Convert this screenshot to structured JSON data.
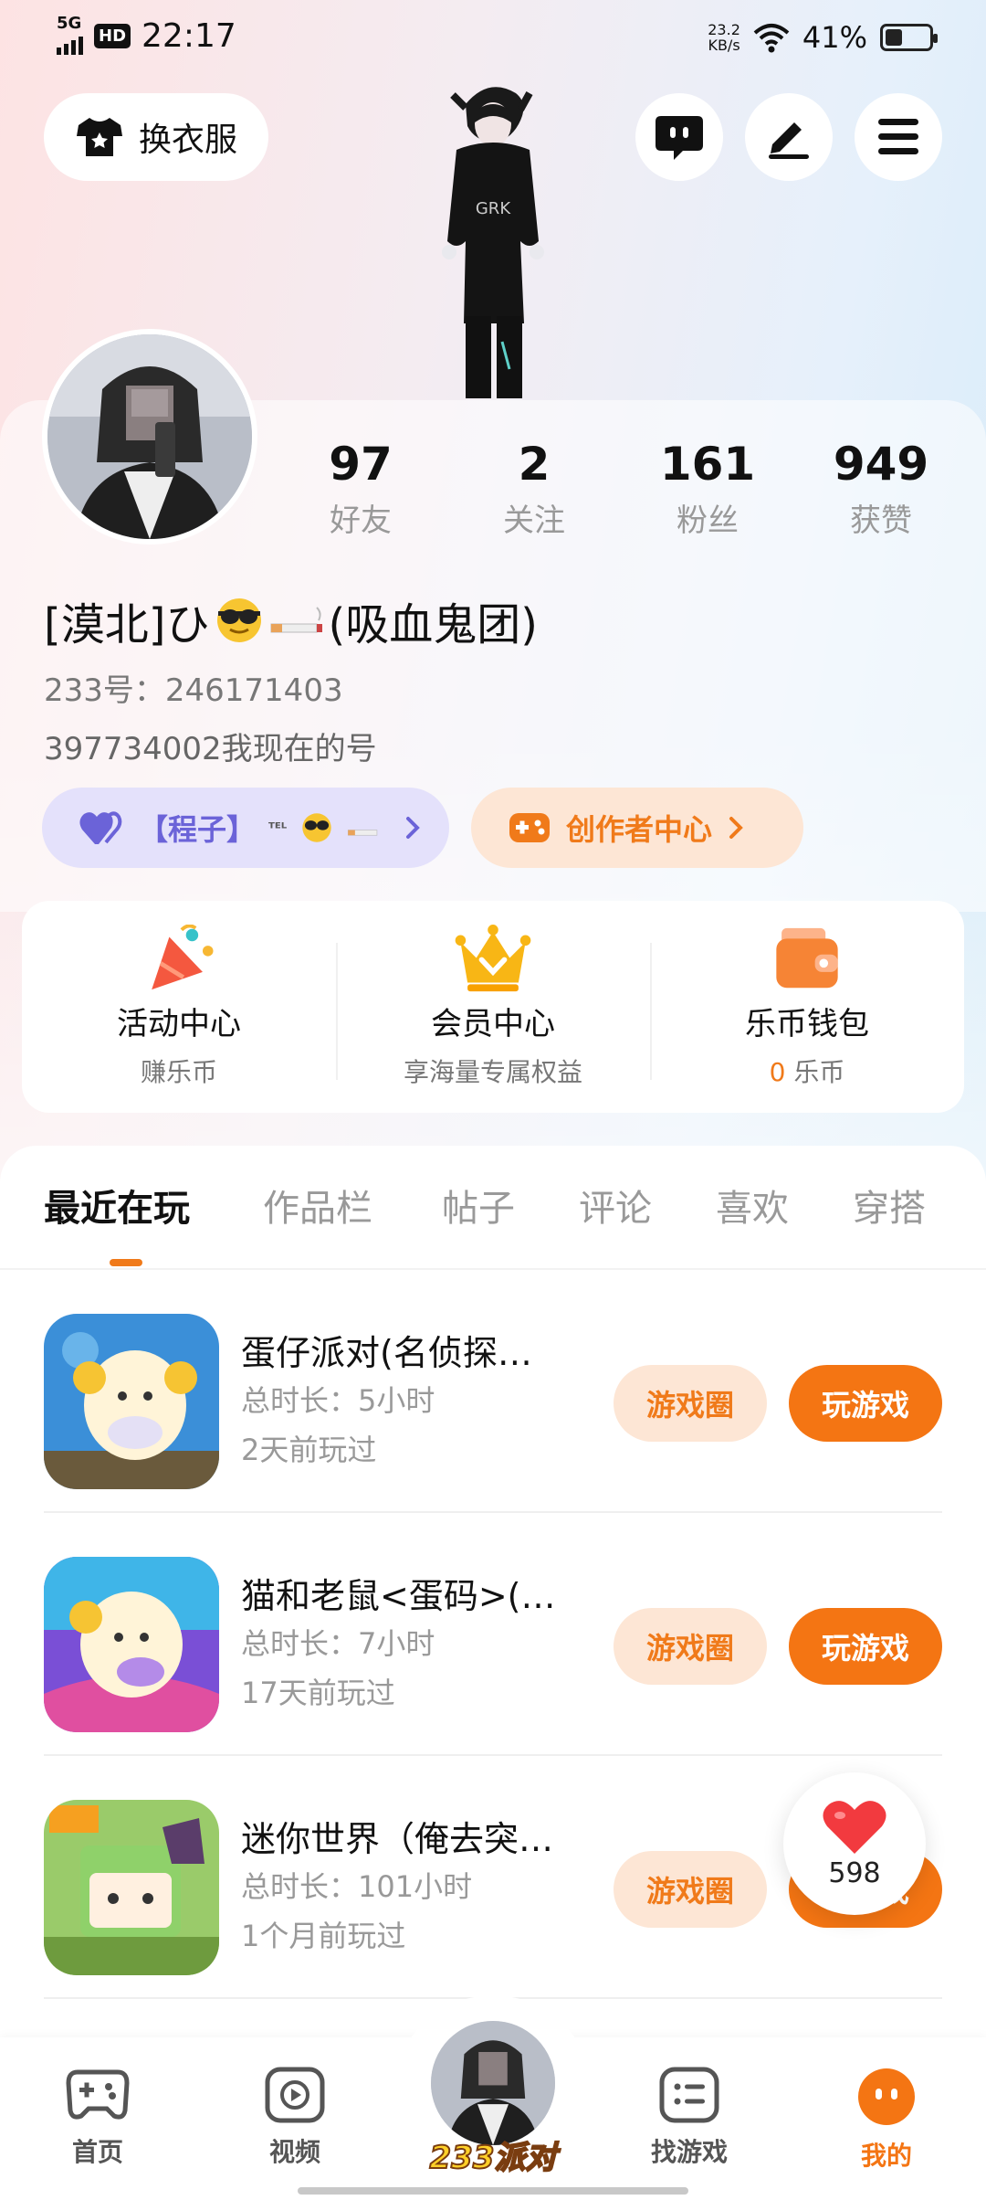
{
  "status_bar": {
    "network": "5G",
    "hd": "HD",
    "time": "22:17",
    "speed_value": "23.2",
    "speed_unit": "KB/s",
    "battery_percent": "41%"
  },
  "header": {
    "dress_button_label": "换衣服",
    "icons": [
      "shirt-icon",
      "chat-icon",
      "edit-icon",
      "menu-icon"
    ]
  },
  "profile": {
    "stats": [
      {
        "value": "97",
        "label": "好友"
      },
      {
        "value": "2",
        "label": "关注"
      },
      {
        "value": "161",
        "label": "粉丝"
      },
      {
        "value": "949",
        "label": "获赞"
      }
    ],
    "nickname_prefix": "[漠北]ひ",
    "nickname_suffix": "(吸血鬼团)",
    "uid": "233号：246171403",
    "signature": "397734002我现在的号",
    "guild_tag": "【程子】",
    "guild_tag_tail": "ᵀᴱᴸ",
    "creator_center": "创作者中心"
  },
  "quick_entries": [
    {
      "title": "活动中心",
      "subtitle": "赚乐币"
    },
    {
      "title": "会员中心",
      "subtitle": "享海量专属权益"
    },
    {
      "title": "乐币钱包",
      "subtitle_value": "0",
      "subtitle_unit": "乐币"
    }
  ],
  "tabs": [
    "最近在玩",
    "作品栏",
    "帖子",
    "评论",
    "喜欢",
    "穿搭"
  ],
  "active_tab": "最近在玩",
  "games": [
    {
      "name": "蛋仔派对(名侦探…",
      "duration": "总时长：5小时",
      "last_played": "2天前玩过",
      "circle_btn": "游戏圈",
      "play_btn": "玩游戏"
    },
    {
      "name": "猫和老鼠<蛋码>(…",
      "duration": "总时长：7小时",
      "last_played": "17天前玩过",
      "circle_btn": "游戏圈",
      "play_btn": "玩游戏"
    },
    {
      "name": "迷你世界（俺去突…",
      "duration": "总时长：101小时",
      "last_played": "1个月前玩过",
      "circle_btn": "游戏圈",
      "play_btn": "玩游戏"
    }
  ],
  "like_float": {
    "count": "598"
  },
  "bottom_nav": [
    {
      "label": "首页",
      "icon": "gamepad-icon"
    },
    {
      "label": "视频",
      "icon": "play-icon"
    },
    {
      "label": "233派对",
      "icon": "avatar-center"
    },
    {
      "label": "找游戏",
      "icon": "list-icon"
    },
    {
      "label": "我的",
      "icon": "me-icon"
    }
  ],
  "colors": {
    "accent": "#f47513",
    "guild": "#6b63d8"
  }
}
